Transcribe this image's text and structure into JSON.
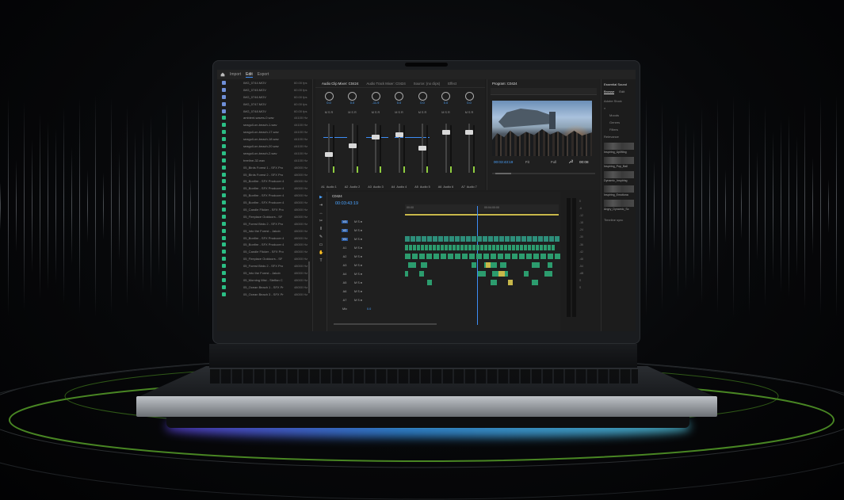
{
  "app": {
    "tabs": [
      "Import",
      "Edit",
      "Export"
    ],
    "active_tab": "Edit"
  },
  "browser": {
    "clips": [
      {
        "name": "IMG_0744.MOV",
        "rate": "60.00 fps",
        "kind": "video"
      },
      {
        "name": "IMG_0745.MOV",
        "rate": "60.00 fps",
        "kind": "video"
      },
      {
        "name": "IMG_0746.MOV",
        "rate": "60.00 fps",
        "kind": "video"
      },
      {
        "name": "IMG_0747.MOV",
        "rate": "60.00 fps",
        "kind": "video"
      },
      {
        "name": "IMG_0748.MOV",
        "rate": "60.00 fps",
        "kind": "video"
      },
      {
        "name": "ambient-waves-0.wav",
        "rate": "44100 Hz",
        "kind": "audio"
      },
      {
        "name": "seagull-on-beach-1.wav",
        "rate": "44100 Hz",
        "kind": "audio"
      },
      {
        "name": "seagull-on-beach-17.wav",
        "rate": "44100 Hz",
        "kind": "audio"
      },
      {
        "name": "seagull-on-beach-18.wav",
        "rate": "44100 Hz",
        "kind": "audio"
      },
      {
        "name": "seagull-on-beach-20.wav",
        "rate": "44100 Hz",
        "kind": "audio"
      },
      {
        "name": "seagull-on-beach-2.wav",
        "rate": "44100 Hz",
        "kind": "audio"
      },
      {
        "name": "treeline-32.wav",
        "rate": "44100 Hz",
        "kind": "audio"
      },
      {
        "name": "05_Birds Forest 1 - SFX Pro",
        "rate": "48000 Hz",
        "kind": "audio"
      },
      {
        "name": "05_Birds Forest 2 - SFX Pro",
        "rate": "48000 Hz",
        "kind": "audio"
      },
      {
        "name": "05_Bonfire - SFX Producer 4",
        "rate": "48000 Hz",
        "kind": "audio"
      },
      {
        "name": "05_Bonfire - SFX Producer 4",
        "rate": "48000 Hz",
        "kind": "audio"
      },
      {
        "name": "05_Bonfire - SFX Producer 4",
        "rate": "48000 Hz",
        "kind": "audio"
      },
      {
        "name": "05_Bonfire - SFX Producer 4",
        "rate": "48000 Hz",
        "kind": "audio"
      },
      {
        "name": "05_Candle Flicker - SFX Pro",
        "rate": "48000 Hz",
        "kind": "audio"
      },
      {
        "name": "05_Fireplace Outdoors - SF",
        "rate": "48000 Hz",
        "kind": "audio"
      },
      {
        "name": "05_Forest Birds 2 - SFX Pro",
        "rate": "48000 Hz",
        "kind": "audio"
      },
      {
        "name": "05_Into the Forest - Jakob",
        "rate": "48000 Hz",
        "kind": "audio"
      },
      {
        "name": "05_Bonfire - SFX Producer 4",
        "rate": "48000 Hz",
        "kind": "audio"
      },
      {
        "name": "05_Bonfire - SFX Producer 4",
        "rate": "48000 Hz",
        "kind": "audio"
      },
      {
        "name": "05_Candle Flicker - SFX Pro",
        "rate": "48000 Hz",
        "kind": "audio"
      },
      {
        "name": "05_Fireplace Outdoors - SF",
        "rate": "48000 Hz",
        "kind": "audio"
      },
      {
        "name": "05_Forest Birds 2 - SFX Pro",
        "rate": "48000 Hz",
        "kind": "audio"
      },
      {
        "name": "05_Into the Forest - Jakob",
        "rate": "48000 Hz",
        "kind": "audio"
      },
      {
        "name": "05_Morning Mist - Steffan C",
        "rate": "48000 Hz",
        "kind": "audio"
      },
      {
        "name": "05_Ocean Beach 1 - SFX Pr",
        "rate": "48000 Hz",
        "kind": "audio"
      },
      {
        "name": "05_Ocean Beach 3 - SFX Pr",
        "rate": "48000 Hz",
        "kind": "audio"
      }
    ]
  },
  "mixer": {
    "tabs": [
      "Audio Clip Mixer: C0424",
      "Audio Track Mixer: C0424",
      "Source: (no clips)",
      "Effect"
    ],
    "channels": [
      {
        "name": "Audio 1",
        "value": "0.0",
        "fader": 0.35
      },
      {
        "name": "Audio 2",
        "value": "0.0",
        "fader": 0.55
      },
      {
        "name": "Audio 3",
        "value": "-11.9",
        "fader": 0.75
      },
      {
        "name": "Audio 4",
        "value": "0.0",
        "fader": 0.8
      },
      {
        "name": "Audio 5",
        "value": "0.0",
        "fader": 0.5
      },
      {
        "name": "Audio 6",
        "value": "0.0",
        "fader": 0.85
      },
      {
        "name": "Audio 7",
        "value": "0.0",
        "fader": 0.85
      }
    ],
    "row_labels": [
      "A1",
      "A2",
      "A3",
      "A4",
      "A5",
      "A6",
      "A7"
    ]
  },
  "program": {
    "title": "Program: C0424",
    "timecode": "00:03:43:19",
    "fit": "Fit",
    "quality": "Full",
    "duration": "00:08"
  },
  "essential": {
    "title": "Essential Sound",
    "tabs": [
      "Browse",
      "Edit"
    ],
    "adobe_stock": "Adobe Stock",
    "filters": [
      "Moods",
      "Genres",
      "Filters"
    ],
    "sort": "Relevance",
    "results": [
      "Inspiring_Uplifting",
      "Inspiring_Pop_Ball",
      "Dynamic_Inspiring",
      "Inspiring_Emotiona",
      "Angry_Dynamic_Sc"
    ],
    "checkbox": "Timeline sync"
  },
  "timeline": {
    "sequence": "C0424",
    "timecode": "00:03:43:19",
    "ruler_labels": [
      "00:00",
      "00:04:00:00"
    ],
    "tracks": [
      "V3",
      "V2",
      "V1",
      "A1",
      "A2",
      "A3",
      "A4",
      "A5",
      "A6",
      "A7",
      "Mix"
    ],
    "mix_value": "0.0"
  },
  "meters": {
    "scale": [
      "0",
      "-6",
      "-12",
      "-18",
      "-24",
      "-30",
      "-36",
      "-42",
      "-48",
      "-54",
      "-dB",
      "S",
      "S"
    ]
  },
  "colors": {
    "accent": "#3d8df5",
    "audio_clip": "#2c9c6e",
    "video_clip": "#2d8e7a",
    "work_area": "#c7b74a",
    "video_clip_icon": "#6f8fd8",
    "audio_clip_icon": "#2bbf85"
  }
}
